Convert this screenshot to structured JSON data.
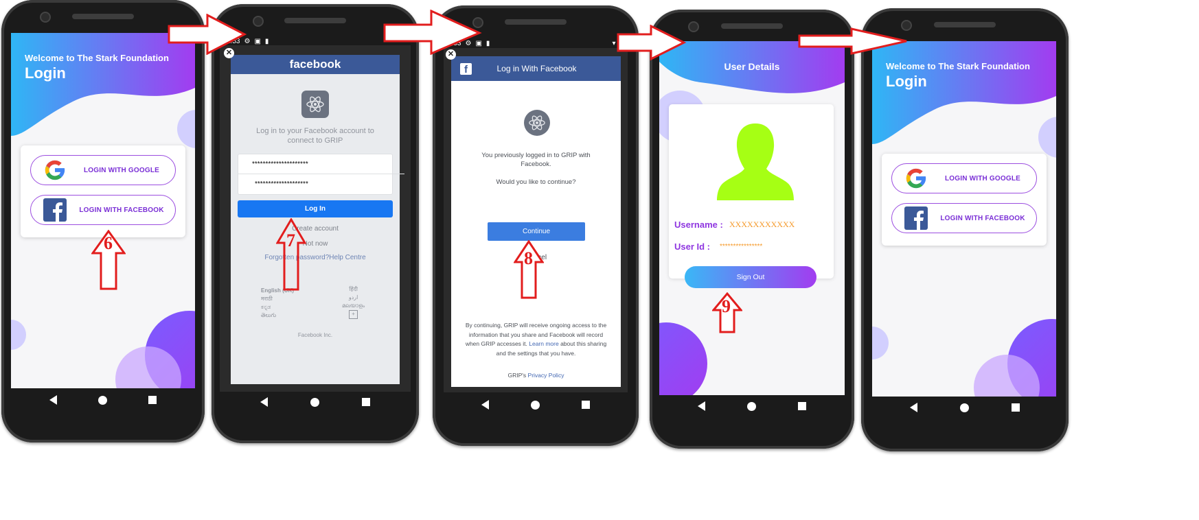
{
  "screen1": {
    "welcome": "Welcome to The Stark Foundation",
    "title": "Login",
    "google_btn": "LOGIN WITH GOOGLE",
    "facebook_btn": "LOGIN WITH FACEBOOK",
    "step": "6"
  },
  "screen2": {
    "status_time": "2:53",
    "fb_logo": "facebook",
    "prompt": "Log in to your Facebook account to connect to GRIP",
    "email_value": "*********************",
    "password_value": "********************",
    "login_btn": "Log In",
    "create_account": "Create account",
    "not_now": "Not now",
    "forgot": "Forgotten password?",
    "help": "Help Centre",
    "languages_left": [
      "English (UK)",
      "मराठी",
      "ಕನ್ನಡ",
      "తెలుగు"
    ],
    "languages_right": [
      "हिंदी",
      "اردو",
      "മലയാളം"
    ],
    "more_languages": "+",
    "footer": "Facebook Inc.",
    "step": "7"
  },
  "screen3": {
    "status_time": "2:53",
    "header": "Log in With Facebook",
    "previous": "You previously logged in to GRIP with Facebook.",
    "continue_q": "Would you like to continue?",
    "continue_btn": "Continue",
    "cancel": "Cancel",
    "disclaimer_a": "By continuing, GRIP will receive ongoing access to the information that you share and Facebook will record when GRIP accesses it. ",
    "learn_more": "Learn more",
    "disclaimer_b": " about this sharing and the settings that you have.",
    "policy_prefix": "GRIP's ",
    "policy_link": "Privacy Policy",
    "step": "8"
  },
  "screen4": {
    "title": "User Details",
    "username_label": "Username :",
    "username_value": "XXXXXXXXXXX",
    "userid_label": "User Id :",
    "userid_value": "****************",
    "signout_btn": "Sign Out",
    "step": "9"
  },
  "screen5": {
    "welcome": "Welcome to The Stark Foundation",
    "title": "Login",
    "google_btn": "LOGIN WITH GOOGLE",
    "facebook_btn": "LOGIN WITH FACEBOOK"
  },
  "colors": {
    "gradient_start": "#2fb6f5",
    "gradient_end": "#a23cf0",
    "fb_blue": "#3b5998",
    "fb_button": "#1877f2",
    "arrow_red": "#e21d1d",
    "avatar_green": "#a6ff14",
    "label_purple": "#8e35e0",
    "value_orange": "#f59a2b"
  },
  "icons": [
    "google-icon",
    "facebook-icon",
    "react-atom-icon",
    "close-icon",
    "user-avatar-icon",
    "back-icon",
    "home-icon",
    "recents-icon",
    "red-arrow-icon"
  ]
}
